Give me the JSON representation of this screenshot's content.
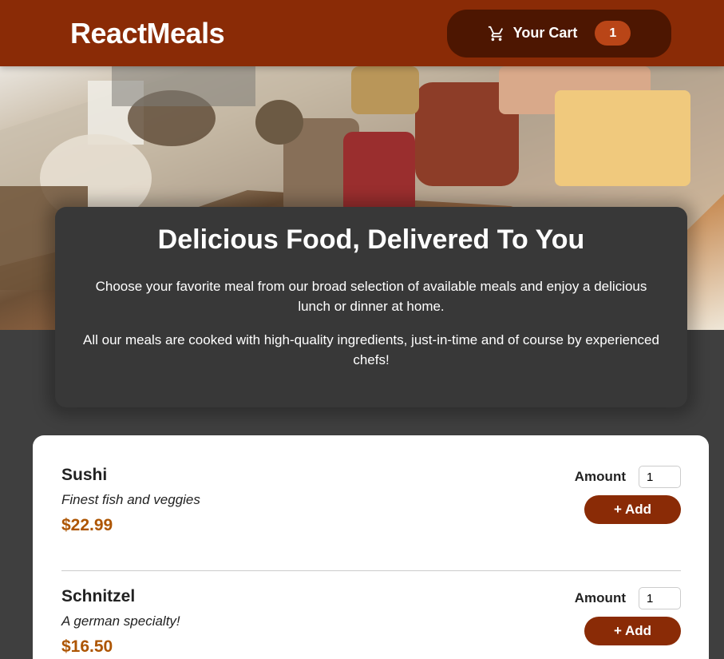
{
  "header": {
    "brand": "ReactMeals",
    "cart": {
      "icon": "cart-icon",
      "label": "Your Cart",
      "count": "1"
    }
  },
  "summary": {
    "title": "Delicious Food, Delivered To You",
    "paragraph_1": "Choose your favorite meal from our broad selection of available meals and enjoy a delicious lunch or dinner at home.",
    "paragraph_2": "All our meals are cooked with high-quality ingredients, just-in-time and of course by experienced chefs!"
  },
  "meals": [
    {
      "name": "Sushi",
      "description": "Finest fish and veggies",
      "price": "$22.99",
      "amount_label": "Amount",
      "amount_value": "1",
      "add_label": "+ Add"
    },
    {
      "name": "Schnitzel",
      "description": "A german specialty!",
      "price": "$16.50",
      "amount_label": "Amount",
      "amount_value": "1",
      "add_label": "+ Add"
    }
  ],
  "colors": {
    "header": "#8a2b06",
    "cart_button": "#4d1601",
    "badge": "#b94517",
    "price": "#ad5502",
    "background": "#3f3f3f",
    "summary": "#383838"
  }
}
